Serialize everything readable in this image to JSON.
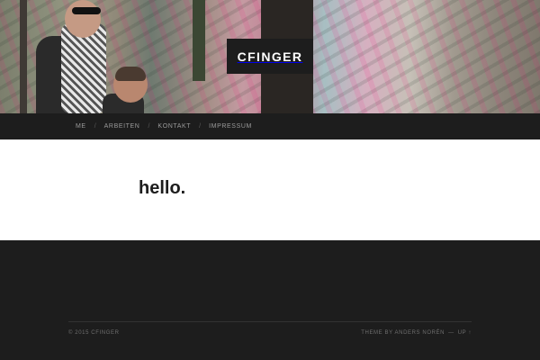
{
  "site": {
    "title": "CFINGER"
  },
  "nav": {
    "items": [
      {
        "label": "ME"
      },
      {
        "label": "ARBEITEN"
      },
      {
        "label": "KONTAKT"
      },
      {
        "label": "IMPRESSUM"
      }
    ],
    "separator": "/"
  },
  "post": {
    "title": "hello."
  },
  "footer": {
    "copyright": "© 2015 CFINGER",
    "theme_credit": "THEME BY ANDERS NORÉN",
    "separator": "—",
    "up_link": "UP ↑"
  }
}
